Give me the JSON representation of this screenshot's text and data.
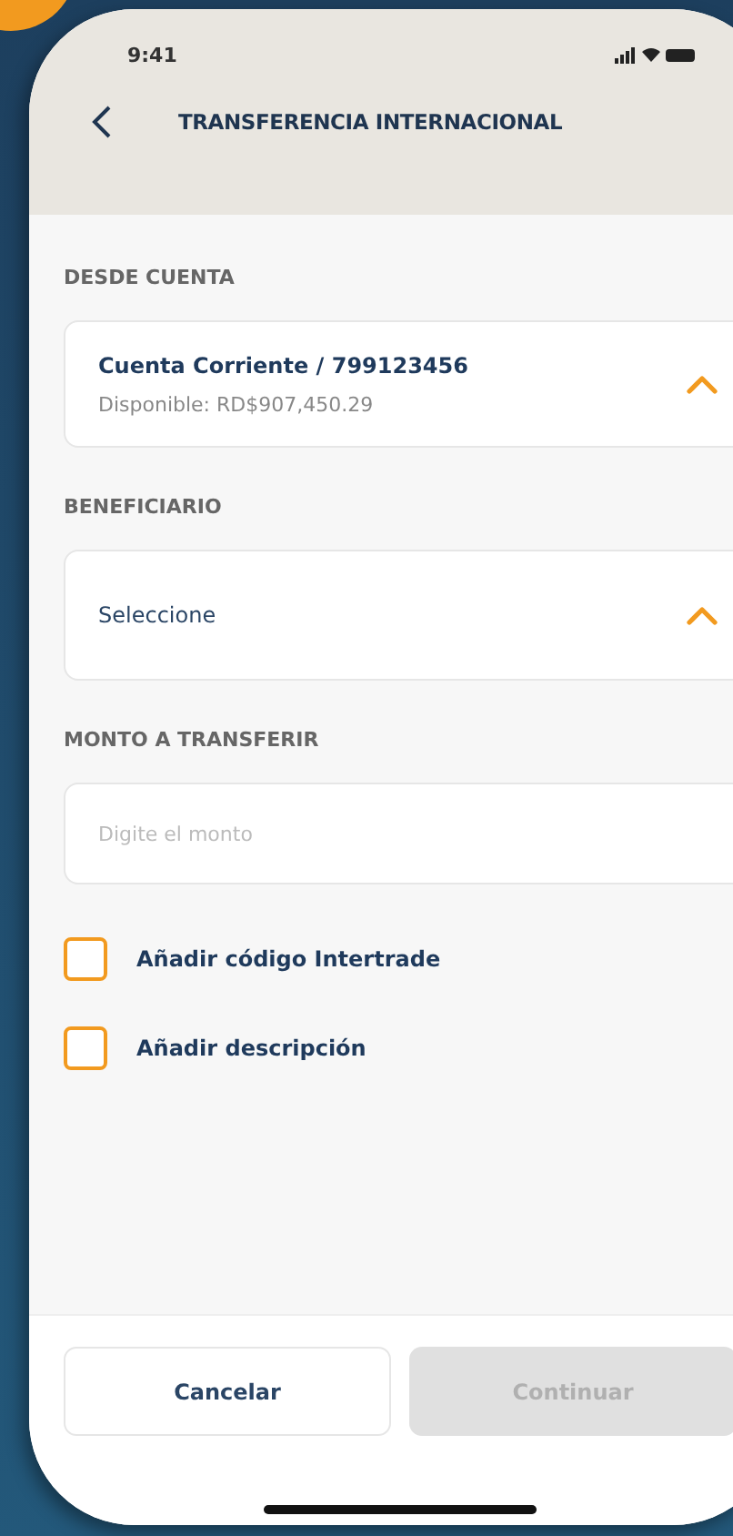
{
  "status_bar": {
    "time": "9:41"
  },
  "header": {
    "title": "TRANSFERENCIA INTERNACIONAL"
  },
  "from_account": {
    "label": "DESDE CUENTA",
    "account": "Cuenta Corriente / 799123456",
    "balance": "Disponible: RD$907,450.29",
    "expanded": true
  },
  "beneficiary": {
    "label": "BENEFICIARIO",
    "value": "Seleccione",
    "expanded": true
  },
  "amount": {
    "label": "MONTO A TRANSFERIR",
    "placeholder": "Digite el monto"
  },
  "options": [
    {
      "label": "Añadir código Intertrade",
      "checked": false
    },
    {
      "label": "Añadir descripción",
      "checked": false
    }
  ],
  "buttons": [
    {
      "label": "Cancelar",
      "kind": "secondary",
      "disabled": false
    },
    {
      "label": "Continuar",
      "kind": "primary",
      "disabled": true
    }
  ]
}
